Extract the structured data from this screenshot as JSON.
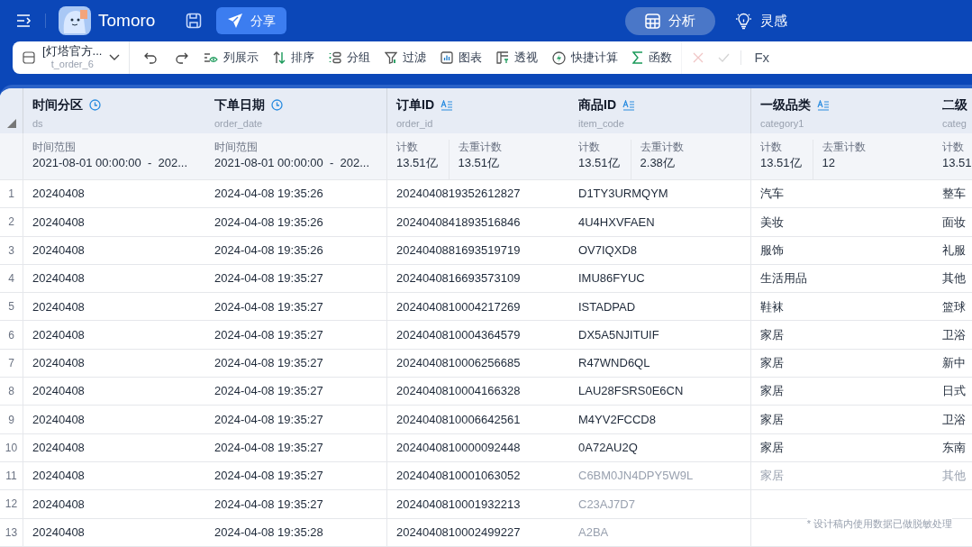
{
  "app": {
    "name": "Tomoro",
    "share_label": "分享"
  },
  "mode_tabs": [
    {
      "label": "分析",
      "selected": true
    },
    {
      "label": "灵感",
      "selected": false
    }
  ],
  "datasource": {
    "title": "[灯塔官方...",
    "subtitle": "t_order_6"
  },
  "toolbar": [
    {
      "label": "列展示"
    },
    {
      "label": "排序"
    },
    {
      "label": "分组"
    },
    {
      "label": "过滤"
    },
    {
      "label": "图表"
    },
    {
      "label": "透视"
    },
    {
      "label": "快捷计算"
    },
    {
      "label": "函数"
    }
  ],
  "formula": {
    "label": "Fx"
  },
  "columns": [
    {
      "title": "时间分区",
      "field": "ds",
      "kind": "time",
      "stats": [
        {
          "label": "时间范围",
          "value": "2021-08-01 00:00:00  -  202..."
        }
      ]
    },
    {
      "title": "下单日期",
      "field": "order_date",
      "kind": "time",
      "stats": [
        {
          "label": "时间范围",
          "value": "2021-08-01 00:00:00  -  202..."
        }
      ]
    },
    {
      "title": "订单ID",
      "field": "order_id",
      "kind": "text",
      "stats": [
        {
          "label": "计数",
          "value": "13.51亿"
        },
        {
          "label": "去重计数",
          "value": "13.51亿"
        }
      ]
    },
    {
      "title": "商品ID",
      "field": "item_code",
      "kind": "text",
      "stats": [
        {
          "label": "计数",
          "value": "13.51亿"
        },
        {
          "label": "去重计数",
          "value": "2.38亿"
        }
      ]
    },
    {
      "title": "一级品类",
      "field": "category1",
      "kind": "text",
      "stats": [
        {
          "label": "计数",
          "value": "13.51亿"
        },
        {
          "label": "去重计数",
          "value": "12"
        }
      ]
    },
    {
      "title": "二级",
      "field": "categ",
      "kind": "plain",
      "stats": [
        {
          "label": "计数",
          "value": "13.51"
        }
      ]
    }
  ],
  "rows": [
    {
      "number": "1",
      "faded": false,
      "cells": [
        "20240408",
        "2024-04-08 19:35:26",
        "2024040819352612827",
        "D1TY3URMQYM",
        "汽车",
        "整车"
      ]
    },
    {
      "number": "2",
      "faded": false,
      "cells": [
        "20240408",
        "2024-04-08 19:35:26",
        "2024040841893516846",
        "4U4HXVFAEN",
        "美妆",
        "面妆"
      ]
    },
    {
      "number": "3",
      "faded": false,
      "cells": [
        "20240408",
        "2024-04-08 19:35:26",
        "2024040881693519719",
        "OV7IQXD8",
        "服饰",
        "礼服"
      ]
    },
    {
      "number": "4",
      "faded": false,
      "cells": [
        "20240408",
        "2024-04-08 19:35:27",
        "2024040816693573109",
        "IMU86FYUC",
        "生活用品",
        "其他"
      ]
    },
    {
      "number": "5",
      "faded": false,
      "cells": [
        "20240408",
        "2024-04-08 19:35:27",
        "2024040810004217269",
        "ISTADPAD",
        "鞋袜",
        "篮球"
      ]
    },
    {
      "number": "6",
      "faded": false,
      "cells": [
        "20240408",
        "2024-04-08 19:35:27",
        "2024040810004364579",
        "DX5A5NJITUIF",
        "家居",
        "卫浴"
      ]
    },
    {
      "number": "7",
      "faded": false,
      "cells": [
        "20240408",
        "2024-04-08 19:35:27",
        "2024040810006256685",
        "R47WND6QL",
        "家居",
        "新中"
      ]
    },
    {
      "number": "8",
      "faded": false,
      "cells": [
        "20240408",
        "2024-04-08 19:35:27",
        "2024040810004166328",
        "LAU28FSRS0E6CN",
        "家居",
        "日式"
      ]
    },
    {
      "number": "9",
      "faded": false,
      "cells": [
        "20240408",
        "2024-04-08 19:35:27",
        "2024040810006642561",
        "M4YV2FCCD8",
        "家居",
        "卫浴"
      ]
    },
    {
      "number": "10",
      "faded": false,
      "cells": [
        "20240408",
        "2024-04-08 19:35:27",
        "2024040810000092448",
        "0A72AU2Q",
        "家居",
        "东南"
      ]
    },
    {
      "number": "11",
      "faded": true,
      "cells": [
        "20240408",
        "2024-04-08 19:35:27",
        "2024040810001063052",
        "C6BM0JN4DPY5W9L",
        "家居",
        "其他"
      ]
    },
    {
      "number": "12",
      "faded": true,
      "cells": [
        "20240408",
        "2024-04-08 19:35:27",
        "2024040810001932213",
        "C23AJ7D7"
      ]
    },
    {
      "number": "13",
      "faded": true,
      "cells": [
        "20240408",
        "2024-04-08 19:35:28",
        "2024040810002499227",
        "A2BA"
      ]
    }
  ],
  "note": "* 设计稿内使用数据已做脱敏处理"
}
